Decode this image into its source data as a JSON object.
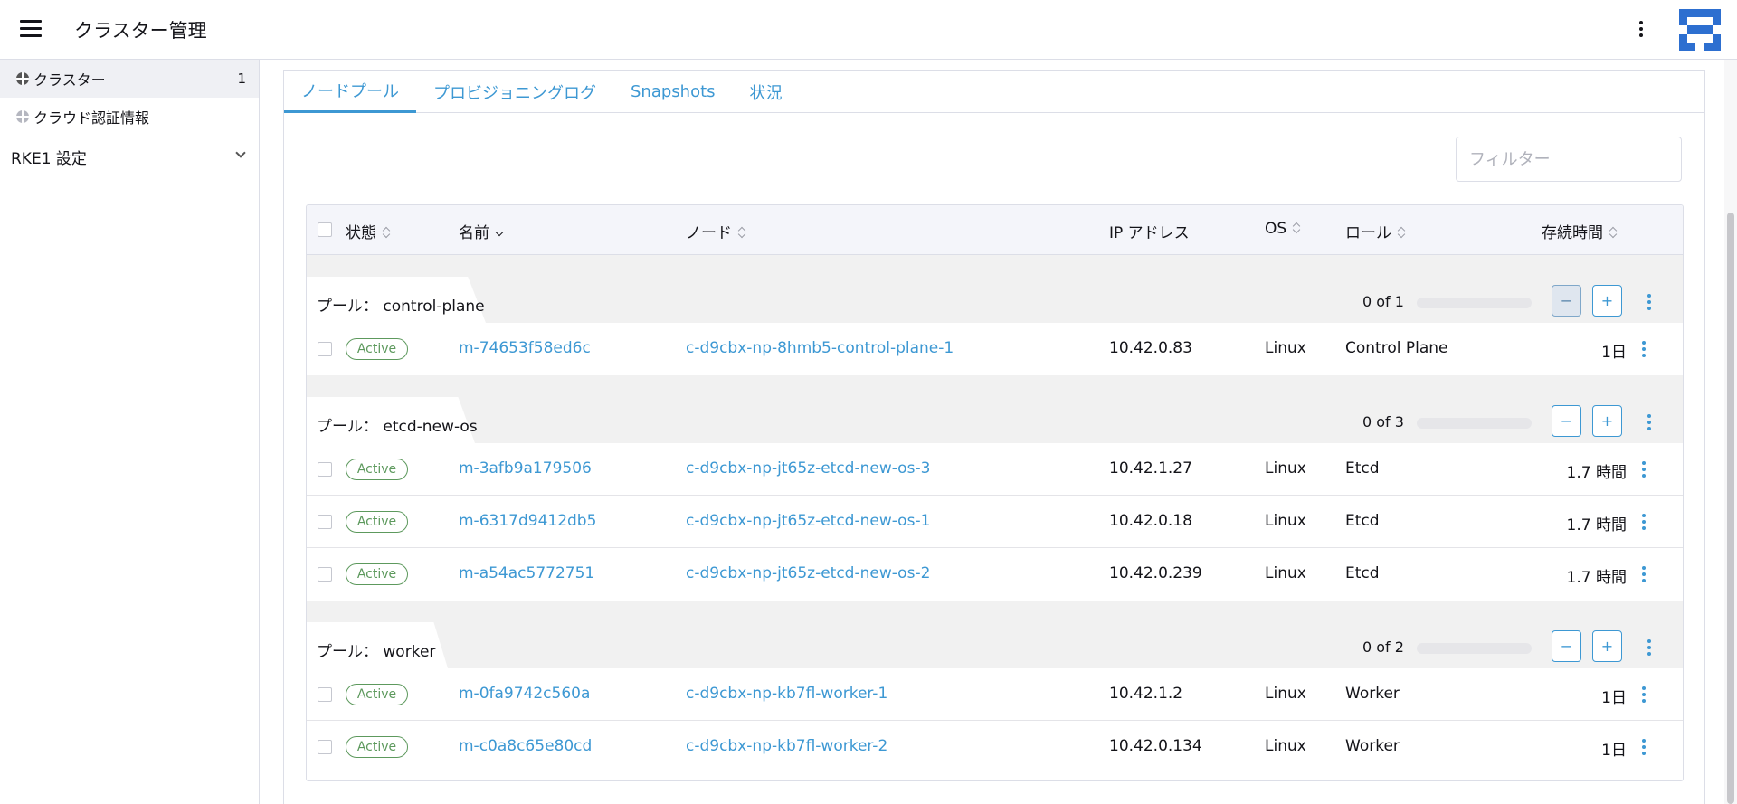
{
  "header": {
    "title": "クラスター管理",
    "menu_icon": "hamburger-icon",
    "more_icon": "kebab-icon",
    "avatar_colors": [
      "#2d6fd0",
      "#ffffff"
    ]
  },
  "sidebar": {
    "items": [
      {
        "label": "クラスター",
        "count": "1",
        "icon": "globe-icon",
        "active": true
      },
      {
        "label": "クラウド認証情報",
        "icon": "globe-icon",
        "active": false
      }
    ],
    "group": {
      "label": "RKE1 設定"
    }
  },
  "tabs": [
    {
      "label": "ノードプール",
      "active": true
    },
    {
      "label": "プロビジョニングログ",
      "active": false
    },
    {
      "label": "Snapshots",
      "active": false
    },
    {
      "label": "状況",
      "active": false
    }
  ],
  "filter": {
    "placeholder": "フィルター"
  },
  "table": {
    "columns": {
      "state": "状態",
      "name": "名前",
      "node": "ノード",
      "ip": "IP アドレス",
      "os": "OS",
      "role": "ロール",
      "age": "存続時間"
    },
    "group_prefix": "プール：",
    "groups": [
      {
        "name": "control-plane",
        "count": "0 of 1",
        "progress": 0,
        "rows": [
          {
            "state": "Active",
            "name": "m-74653f58ed6c",
            "node": "c-d9cbx-np-8hmb5-control-plane-1",
            "ip": "10.42.0.83",
            "os": "Linux",
            "role": "Control Plane",
            "age": "1日"
          }
        ]
      },
      {
        "name": "etcd-new-os",
        "count": "0 of 3",
        "progress": 0,
        "rows": [
          {
            "state": "Active",
            "name": "m-3afb9a179506",
            "node": "c-d9cbx-np-jt65z-etcd-new-os-3",
            "ip": "10.42.1.27",
            "os": "Linux",
            "role": "Etcd",
            "age": "1.7 時間"
          },
          {
            "state": "Active",
            "name": "m-6317d9412db5",
            "node": "c-d9cbx-np-jt65z-etcd-new-os-1",
            "ip": "10.42.0.18",
            "os": "Linux",
            "role": "Etcd",
            "age": "1.7 時間"
          },
          {
            "state": "Active",
            "name": "m-a54ac5772751",
            "node": "c-d9cbx-np-jt65z-etcd-new-os-2",
            "ip": "10.42.0.239",
            "os": "Linux",
            "role": "Etcd",
            "age": "1.7 時間"
          }
        ]
      },
      {
        "name": "worker",
        "count": "0 of 2",
        "progress": 0,
        "rows": [
          {
            "state": "Active",
            "name": "m-0fa9742c560a",
            "node": "c-d9cbx-np-kb7fl-worker-1",
            "ip": "10.42.1.2",
            "os": "Linux",
            "role": "Worker",
            "age": "1日"
          },
          {
            "state": "Active",
            "name": "m-c0a8c65e80cd",
            "node": "c-d9cbx-np-kb7fl-worker-2",
            "ip": "10.42.0.134",
            "os": "Linux",
            "role": "Worker",
            "age": "1日"
          }
        ]
      }
    ],
    "scale_down": "−",
    "scale_up": "+"
  },
  "colors": {
    "accent": "#3d98d3",
    "active_badge": "#5d995d",
    "group_bg": "#f1f1f1",
    "header_bg": "#f4f5fa"
  }
}
